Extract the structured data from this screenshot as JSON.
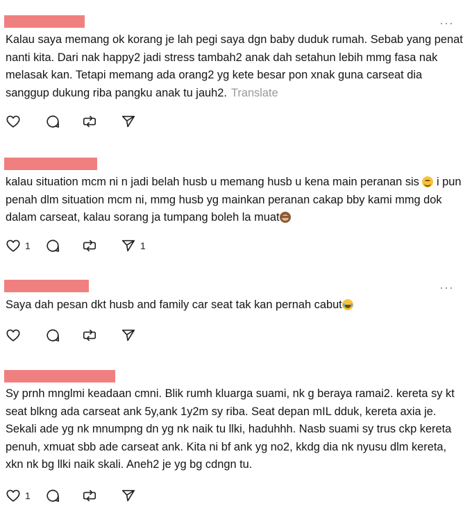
{
  "translate_label": "Translate",
  "more_label": "···",
  "posts": [
    {
      "text": "Kalau saya memang ok korang je lah pegi saya dgn baby duduk rumah. Sebab yang penat nanti kita. Dari nak happy2 jadi stress tambah2 anak dah setahun lebih mmg fasa nak melasak kan. Tetapi memang ada orang2 yg kete besar pon xnak guna carseat dia sanggup dukung riba pangku anak tu jauh2.",
      "like_count": "",
      "repost_count": ""
    },
    {
      "text_a": "kalau situation mcm ni n jadi belah husb u memang husb u kena main peranan sis",
      "emoji_a": "smiling-face-emoji",
      "text_b": " i pun penah dlm situation mcm ni, mmg husb yg mainkan peranan cakap bby kami mmg dok dalam carseat, kalau sorang ja tumpang boleh la muat",
      "emoji_b": "see-no-evil-monkey-emoji",
      "like_count": "1",
      "repost_count": "1"
    },
    {
      "text": "Saya dah pesan dkt husb and family car seat tak kan pernah cabut",
      "emoji": "tears-of-joy-emoji",
      "like_count": "",
      "repost_count": ""
    },
    {
      "text": "Sy prnh mnglmi keadaan cmni. Blik rumh kluarga suami, nk g beraya ramai2. kereta sy kt seat blkng ada carseat ank 5y,ank 1y2m sy riba. Seat depan mIL dduk, kereta axia je. Sekali ade yg nk mnumpng dn yg nk naik tu llki, haduhhh. Nasb suami sy trus ckp kereta penuh, xmuat sbb ade carseat ank. Kita ni bf ank yg no2, kkdg dia nk nyusu dlm kereta, xkn nk bg llki naik skali. Aneh2 je yg bg cdngn tu.",
      "like_count": "1",
      "repost_count": ""
    }
  ]
}
